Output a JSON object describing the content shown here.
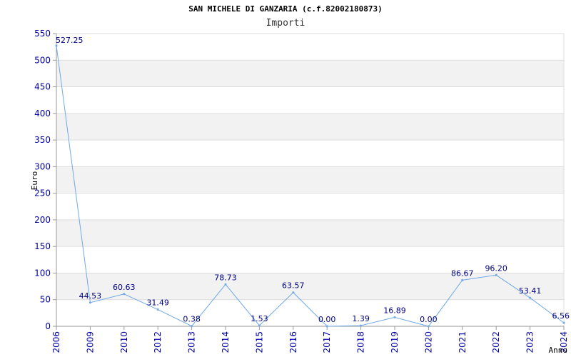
{
  "chart_data": {
    "type": "line",
    "title": "SAN MICHELE DI GANZARIA (c.f.82002180873)",
    "subtitle": "Importi",
    "ylabel": "Euro",
    "xlabel": "Anno",
    "ylim": [
      0,
      550
    ],
    "yticks": [
      0,
      50,
      100,
      150,
      200,
      250,
      300,
      350,
      400,
      450,
      500,
      550
    ],
    "categories": [
      "2006",
      "2009",
      "2010",
      "2012",
      "2013",
      "2014",
      "2015",
      "2016",
      "2017",
      "2018",
      "2019",
      "2020",
      "2021",
      "2022",
      "2023",
      "2024"
    ],
    "values": [
      527.25,
      44.53,
      60.63,
      31.49,
      0.38,
      78.73,
      1.53,
      63.57,
      0.0,
      1.39,
      16.89,
      0.0,
      86.67,
      96.2,
      53.41,
      6.56
    ],
    "value_labels": [
      "527.25",
      "44.53",
      "60.63",
      "31.49",
      "0.38",
      "78.73",
      "1.53",
      "63.57",
      "0.00",
      "1.39",
      "16.89",
      "0.00",
      "86.67",
      "96.20",
      "53.41",
      "6.56"
    ],
    "grid": true,
    "colors": {
      "line": "#6fa8e8",
      "band": "#f2f2f2",
      "grid": "#dddddd",
      "axis": "#999999",
      "tick_text": "#0000aa"
    }
  }
}
